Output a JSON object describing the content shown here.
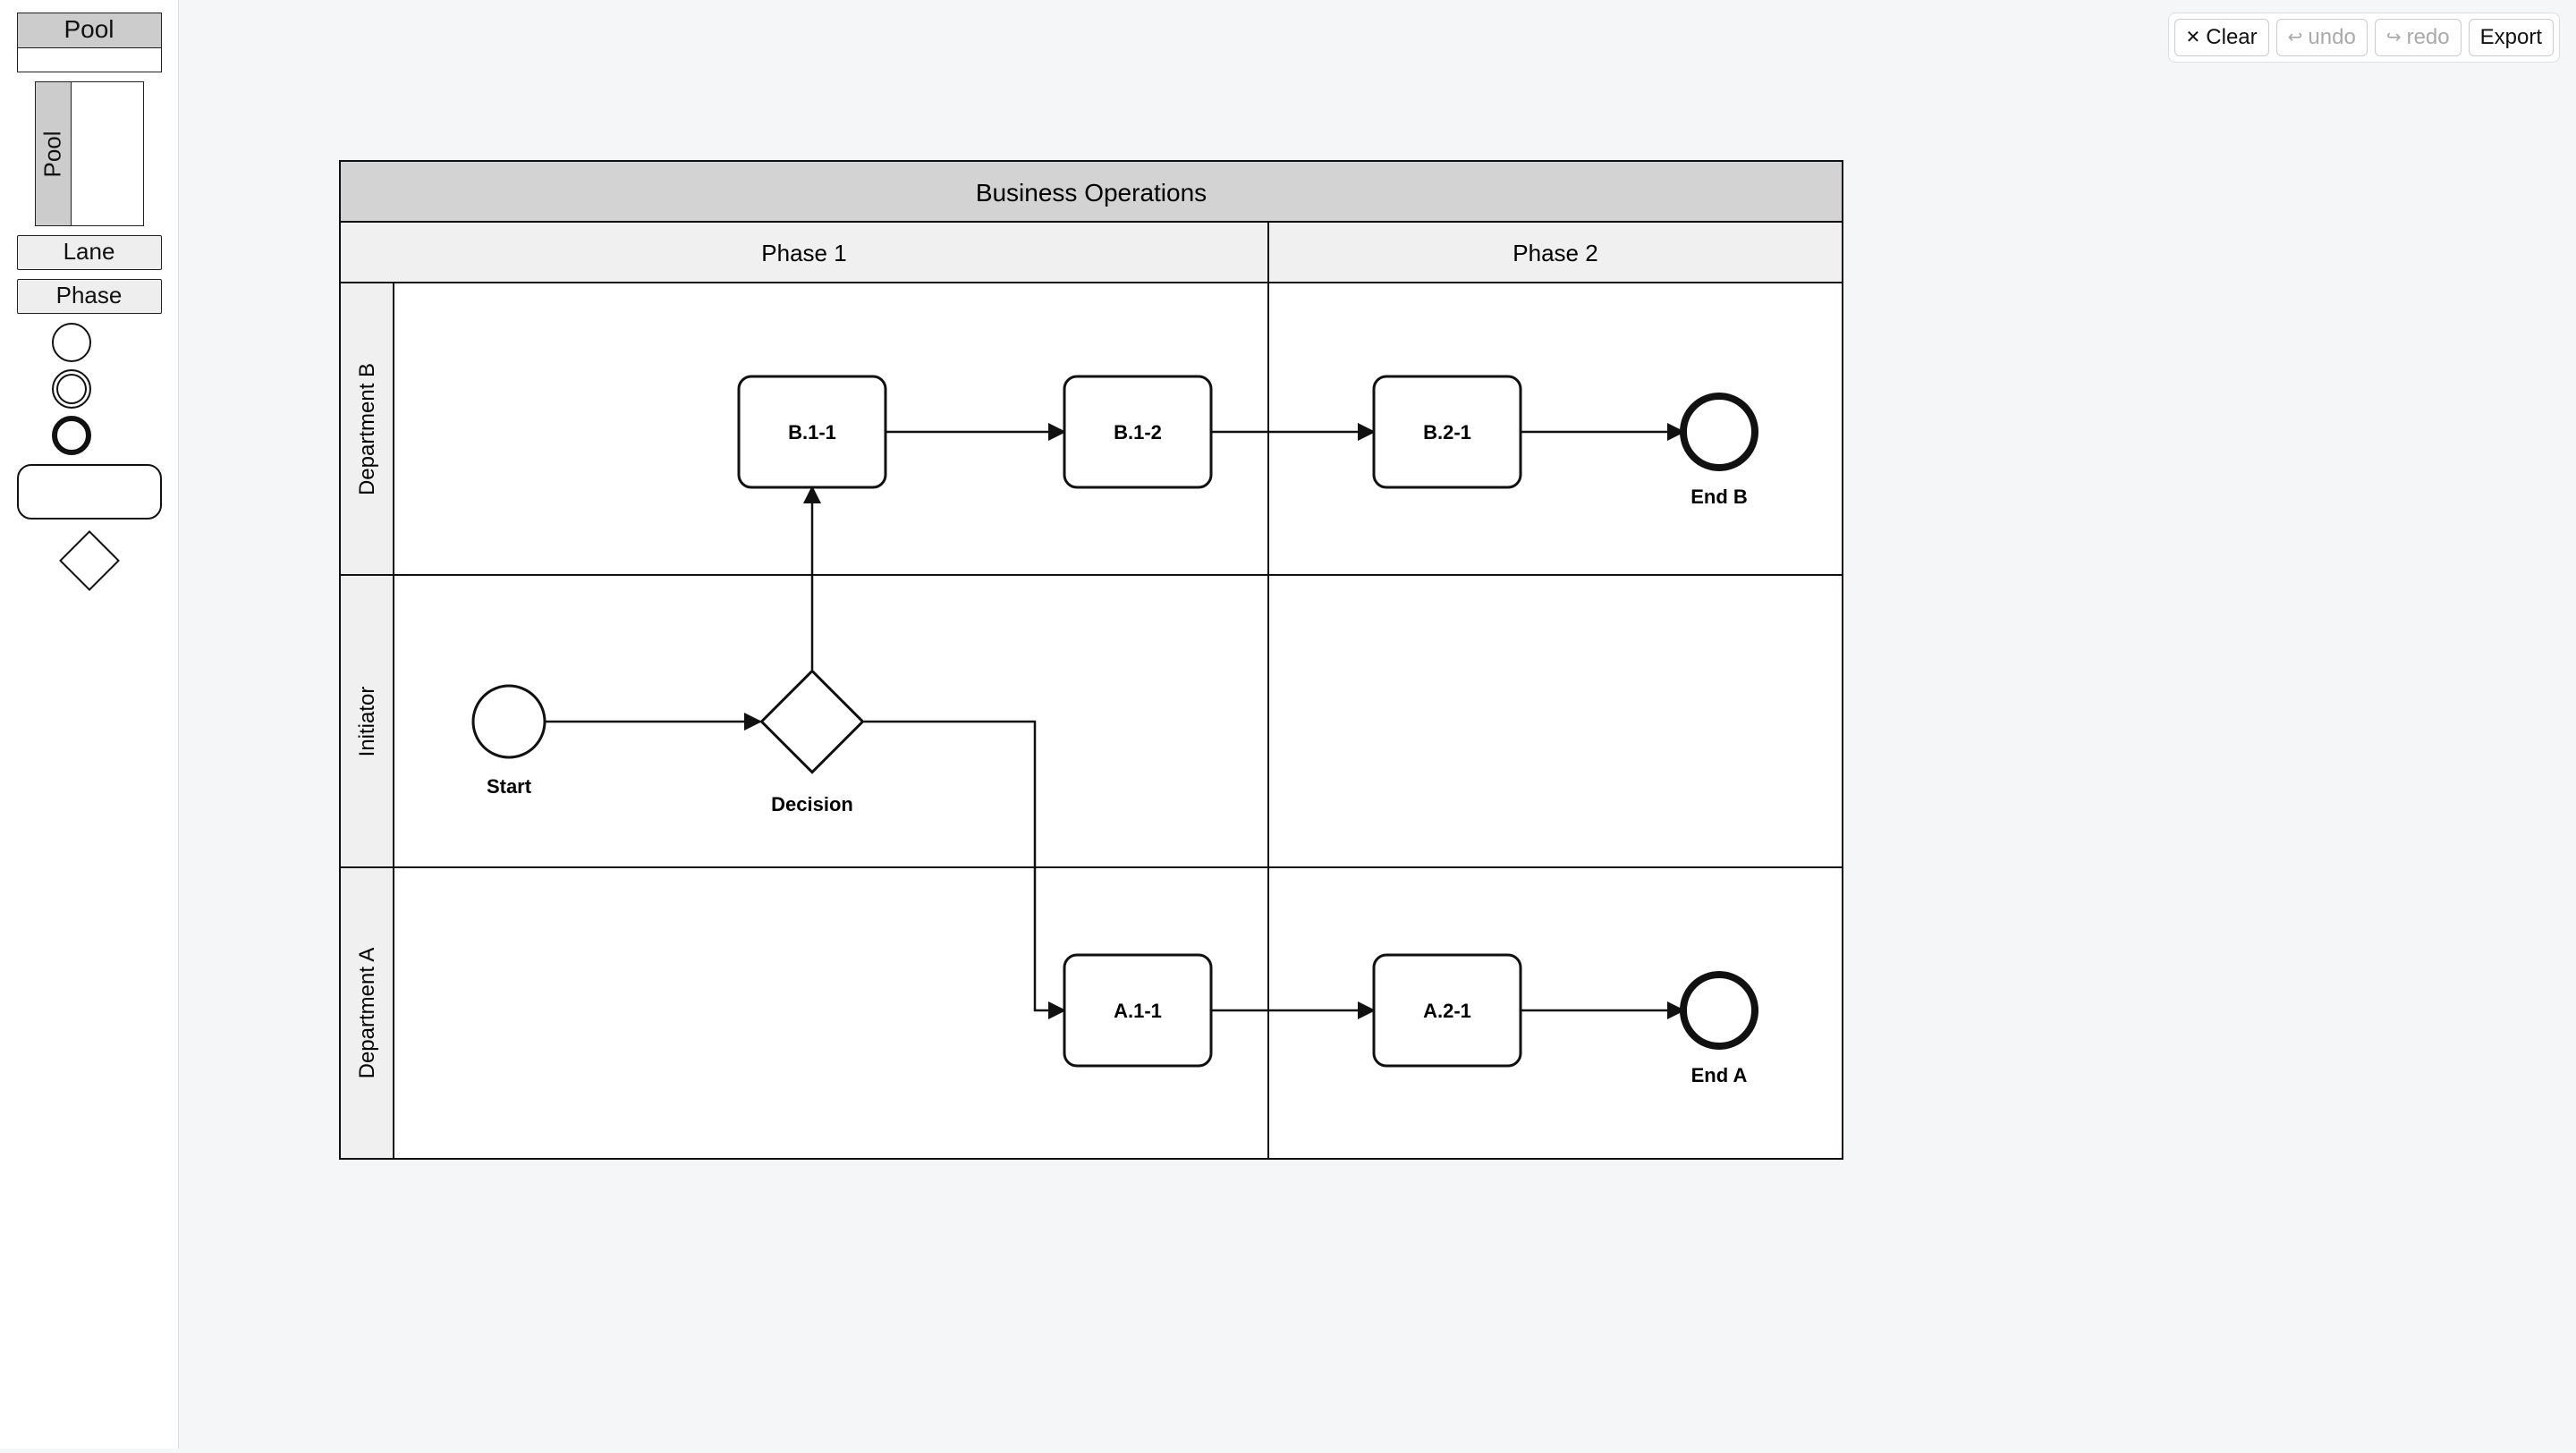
{
  "toolbar": {
    "clear": "Clear",
    "undo": "undo",
    "redo": "redo",
    "export": "Export",
    "undo_enabled": false,
    "redo_enabled": false
  },
  "palette": {
    "hpool_label": "Pool",
    "vpool_label": "Pool",
    "lane_label": "Lane",
    "phase_label": "Phase"
  },
  "diagram": {
    "pool": {
      "title": "Business Operations",
      "phases": [
        "Phase 1",
        "Phase 2"
      ],
      "lanes": [
        "Department B",
        "Initiator",
        "Department A"
      ]
    },
    "nodes": {
      "start": {
        "label": "Start"
      },
      "decision": {
        "label": "Decision"
      },
      "b11": {
        "label": "B.1-1"
      },
      "b12": {
        "label": "B.1-2"
      },
      "b21": {
        "label": "B.2-1"
      },
      "endB": {
        "label": "End B"
      },
      "a11": {
        "label": "A.1-1"
      },
      "a21": {
        "label": "A.2-1"
      },
      "endA": {
        "label": "End A"
      }
    }
  }
}
